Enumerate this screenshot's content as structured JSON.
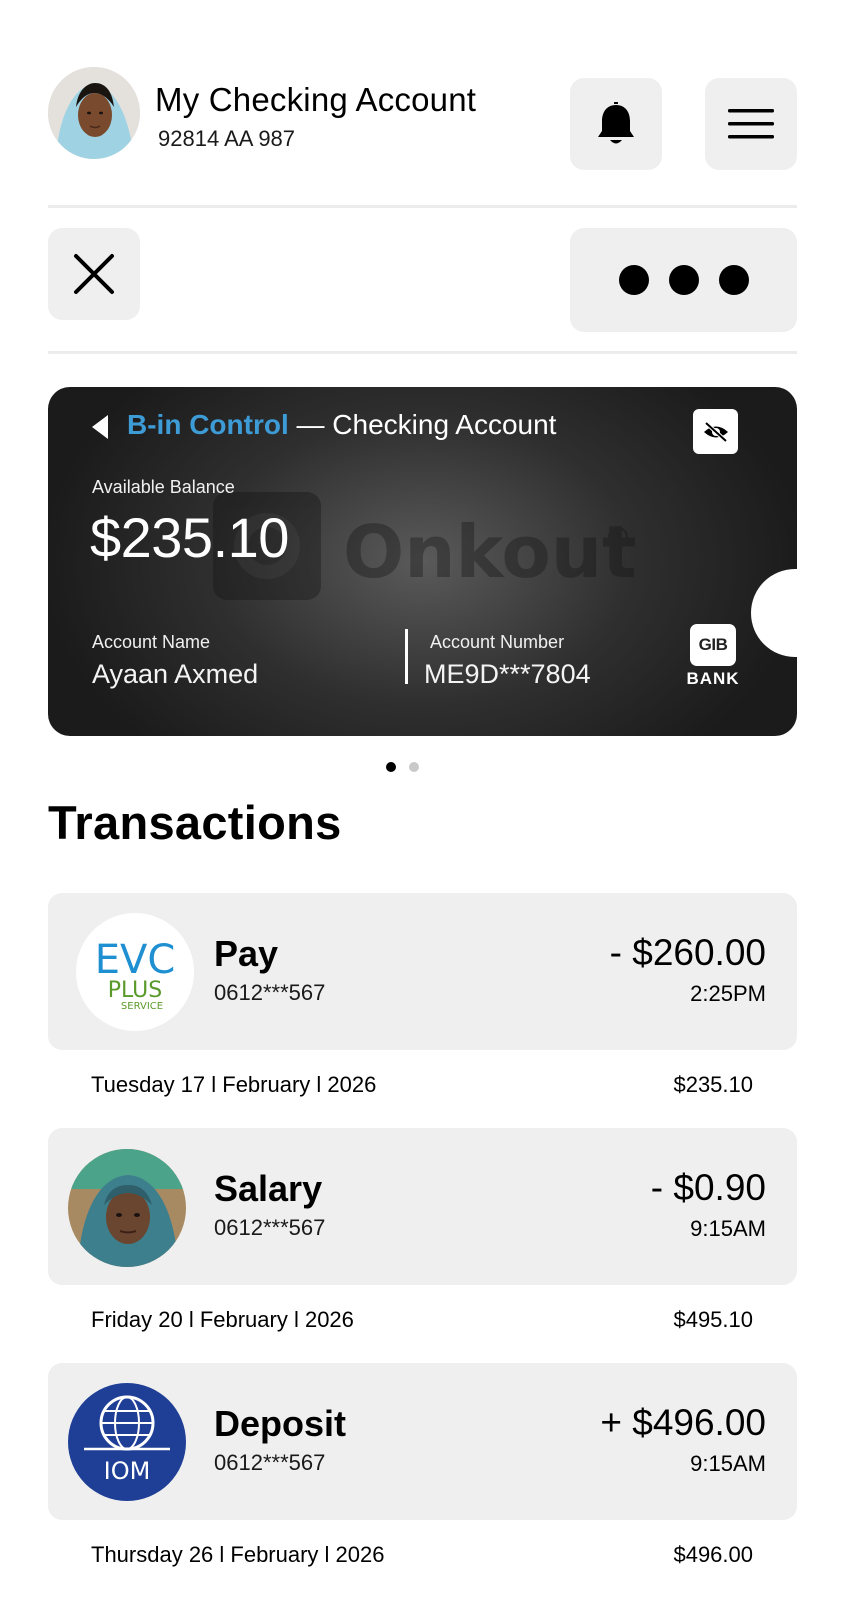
{
  "header": {
    "account_title": "My Checking Account",
    "account_code": "92814 AA 987",
    "avatar_icon": "user-avatar",
    "bell_icon": "bell-icon",
    "menu_icon": "hamburger-menu-icon"
  },
  "toolbar": {
    "close_icon": "close-icon",
    "more_icon": "more-dots-icon"
  },
  "card": {
    "brand": "B-in Control",
    "title_suffix": " — Checking Account",
    "watermark": "Onkout",
    "balance_label": "Available Balance",
    "balance_value": "$235.10",
    "account_name_label": "Account Name",
    "account_name": "Ayaan Axmed",
    "account_number_label": "Account Number",
    "account_number": "ME9D***7804",
    "bank_logo_text": "GIB",
    "bank_label": "BANK",
    "brand_color": "#3d9bd6",
    "hide_balance_icon": "eye-off-icon"
  },
  "pager": {
    "count": 2,
    "active": 1
  },
  "transactions": {
    "title": "Transactions",
    "items": [
      {
        "name": "Pay",
        "account": "0612***567",
        "amount": "- $260.00",
        "time": "2:25PM",
        "date": "Tuesday 17 l February l 2026",
        "balance": "$235.10",
        "logo": {
          "line1": "EVC",
          "line2": "PLUS",
          "line3": "SERVICE"
        }
      },
      {
        "name": "Salary",
        "account": "0612***567",
        "amount": "- $0.90",
        "time": "9:15AM",
        "date": "Friday 20 l February l 2026",
        "balance": "$495.10"
      },
      {
        "name": "Deposit",
        "account": "0612***567",
        "amount": "+ $496.00",
        "time": "9:15AM",
        "date": "Thursday 26 l February l 2026",
        "balance": "$496.00",
        "logo": {
          "text": "IOM"
        }
      }
    ]
  }
}
